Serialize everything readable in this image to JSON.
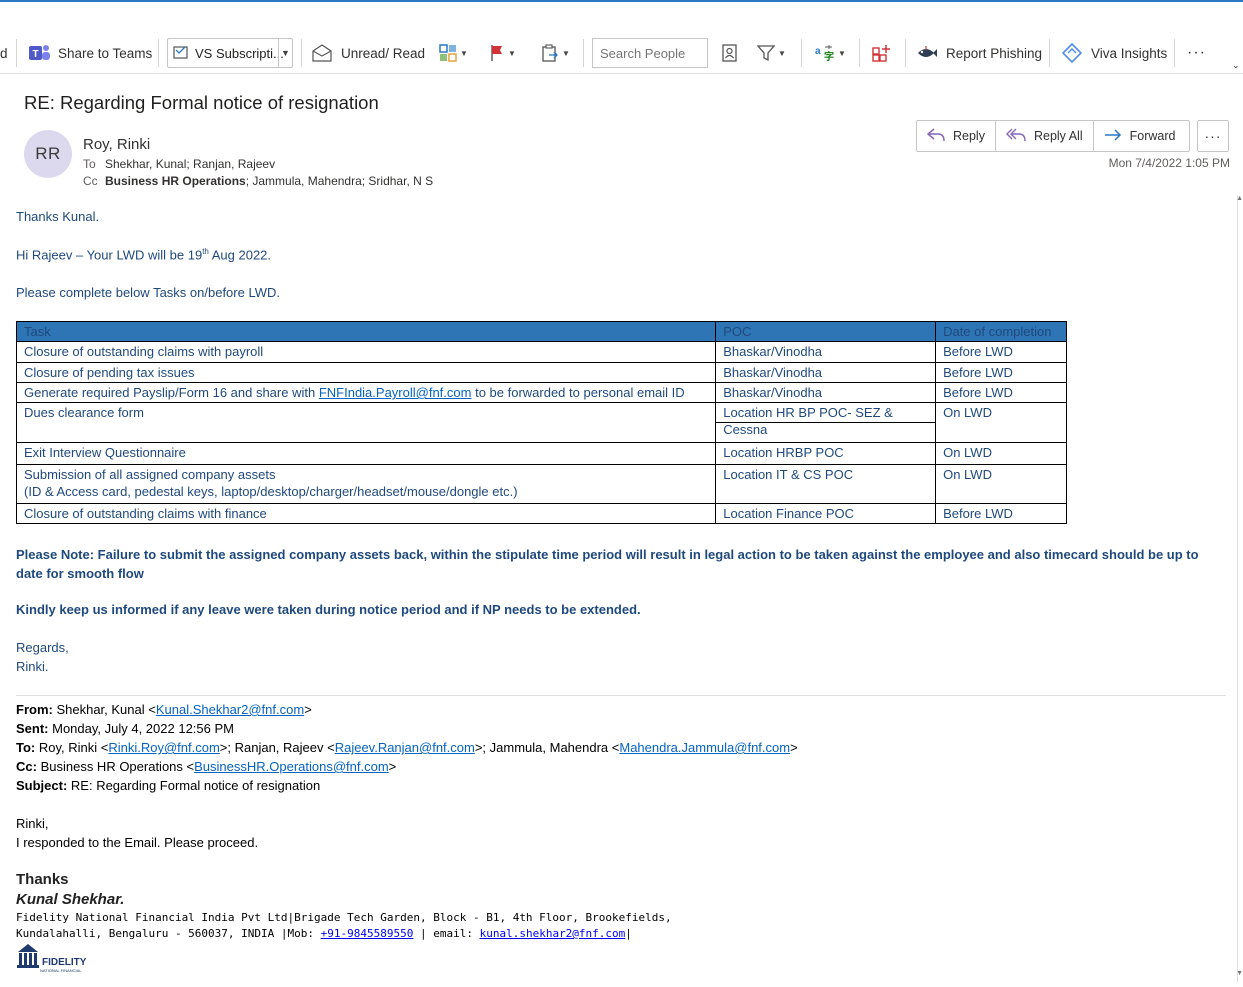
{
  "ribbon": {
    "cut_left_label": "d",
    "share_teams": "Share to Teams",
    "vs_subscription": "VS Subscripti...",
    "unread_read": "Unread/ Read",
    "search_people_placeholder": "Search People",
    "report_phishing": "Report Phishing",
    "viva_insights": "Viva Insights",
    "more": "···"
  },
  "message": {
    "subject": "RE: Regarding Formal notice of resignation",
    "avatar_initials": "RR",
    "sender": "Roy, Rinki",
    "to_label": "To",
    "to": "Shekhar, Kunal; Ranjan, Rajeev",
    "cc_label": "Cc",
    "cc_bold": "Business HR Operations",
    "cc_rest": "; Jammula, Mahendra; Sridhar, N S",
    "date": "Mon 7/4/2022 1:05 PM"
  },
  "actions": {
    "reply": "Reply",
    "reply_all": "Reply All",
    "forward": "Forward",
    "more": "···"
  },
  "body": {
    "line1": "Thanks Kunal.",
    "line2_pre": "Hi Rajeev – Your  LWD will be 19",
    "line2_sup": "th",
    "line2_post": " Aug 2022.",
    "line3": "Please complete below Tasks on/before LWD.",
    "note1": "Please Note: Failure to submit the assigned company assets back, within the stipulate time period will result in legal action to be taken against the employee and also timecard should be up to date for smooth flow",
    "note2": "Kindly keep us informed if any leave were taken during notice period and if NP needs to be extended.",
    "regards": "Regards,",
    "name": "Rinki."
  },
  "tasks_table": {
    "headers": [
      "Task",
      "POC",
      "Date of completion"
    ],
    "rows": [
      {
        "task": "Closure of outstanding claims with payroll",
        "poc": "Bhaskar/Vinodha",
        "date": "Before LWD"
      },
      {
        "task": "Closure of pending tax issues",
        "poc": "Bhaskar/Vinodha",
        "date": "Before LWD"
      },
      {
        "task_pre": "Generate required Payslip/Form 16 and share with ",
        "task_link": "FNFIndia.Payroll@fnf.com",
        "task_post": " to be forwarded to personal email ID",
        "poc": "Bhaskar/Vinodha",
        "date": "Before LWD"
      },
      {
        "task": "Dues clearance form",
        "poc": "Location HR BP POC- SEZ & Cessna",
        "date": "On LWD"
      },
      {
        "task": "Exit Interview Questionnaire",
        "poc": "Location HRBP POC",
        "date": "On LWD"
      },
      {
        "task": "Submission of all assigned company assets",
        "task_line2": "(ID & Access card, pedestal keys, laptop/desktop/charger/headset/mouse/dongle etc.)",
        "poc": "Location IT & CS POC",
        "date": "On LWD"
      },
      {
        "task": "Closure of outstanding claims with finance",
        "poc": "Location Finance POC",
        "date": "Before LWD"
      }
    ]
  },
  "original": {
    "from_label": "From:",
    "from_name": " Shekhar, Kunal <",
    "from_email": "Kunal.Shekhar2@fnf.com",
    "sent_label": "Sent:",
    "sent": " Monday, July 4, 2022 12:56 PM",
    "to_label": "To:",
    "to_name1": " Roy, Rinki <",
    "to_email1": "Rinki.Roy@fnf.com",
    "to_name2": ">; Ranjan, Rajeev <",
    "to_email2": "Rajeev.Ranjan@fnf.com",
    "to_name3": ">; Jammula, Mahendra <",
    "to_email3": "Mahendra.Jammula@fnf.com",
    "cc_label": "Cc:",
    "cc_name": " Business HR Operations <",
    "cc_email": "BusinessHR.Operations@fnf.com",
    "subject_label": "Subject:",
    "subject": " RE: Regarding Formal notice of resignation",
    "greeting": "Rinki,",
    "text": "I responded to the Email. Please proceed.",
    "thanks": "Thanks",
    "sig_name": "Kunal Shekhar.",
    "sig_company": "Fidelity National Financial India Pvt Ltd|Brigade Tech Garden, Block - B1, 4th Floor, Brookefields,",
    "sig_addr_pre": "Kundalahalli, Bengaluru - 560037, INDIA |Mob: ",
    "sig_mob": "+91-9845589550",
    "sig_email_pre": " | email: ",
    "sig_email": "kunal.shekhar2@fnf.com",
    "sig_end": "|",
    "logo_text": "FIDELITY",
    "logo_sub": "NATIONAL FINANCIAL"
  },
  "colors": {
    "accent": "#2b78c5",
    "body_text": "#1f497d",
    "table_header": "#2e75b6",
    "link": "#0563c1",
    "avatar_bg": "#dcd9ee"
  }
}
